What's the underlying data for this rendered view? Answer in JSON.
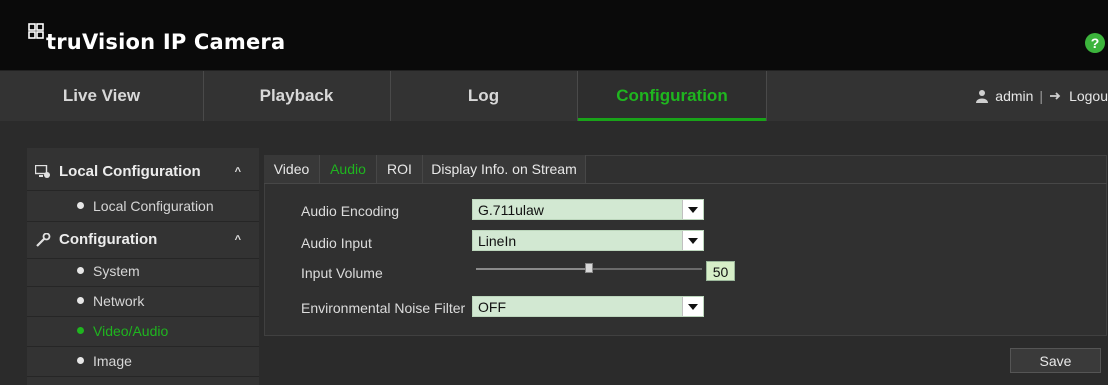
{
  "header": {
    "brand": "truVision IP Camera",
    "logo_icon": "truvision-logo-icon",
    "help_label": "?",
    "colors": {
      "accent": "#1fb51f",
      "header_bg": "#0a0a0a",
      "nav_bg": "#333333",
      "page_bg": "#2b2b2b"
    }
  },
  "nav": {
    "tabs": [
      {
        "label": "Live View"
      },
      {
        "label": "Playback"
      },
      {
        "label": "Log"
      },
      {
        "label": "Configuration",
        "active": true
      }
    ],
    "user": {
      "icon": "user-icon",
      "name": "admin",
      "separator": "|",
      "logout_icon": "logout-icon",
      "logout_label": "Logou"
    }
  },
  "sidebar": {
    "groups": [
      {
        "label": "Local Configuration",
        "icon": "local-config-icon",
        "chevron": "^",
        "items": [
          {
            "label": "Local Configuration"
          }
        ]
      },
      {
        "label": "Configuration",
        "icon": "wrench-icon",
        "chevron": "^",
        "items": [
          {
            "label": "System"
          },
          {
            "label": "Network"
          },
          {
            "label": "Video/Audio",
            "active": true
          },
          {
            "label": "Image"
          }
        ]
      }
    ]
  },
  "subtabs": [
    {
      "label": "Video"
    },
    {
      "label": "Audio",
      "active": true
    },
    {
      "label": "ROI"
    },
    {
      "label": "Display Info. on Stream"
    }
  ],
  "form": {
    "audio_encoding": {
      "label": "Audio Encoding",
      "value": "G.711ulaw"
    },
    "audio_input": {
      "label": "Audio Input",
      "value": "LineIn"
    },
    "input_volume": {
      "label": "Input Volume",
      "value": "50",
      "level": 0.5
    },
    "noise_filter": {
      "label": "Environmental Noise Filter",
      "value": "OFF"
    }
  },
  "save_label": "Save"
}
